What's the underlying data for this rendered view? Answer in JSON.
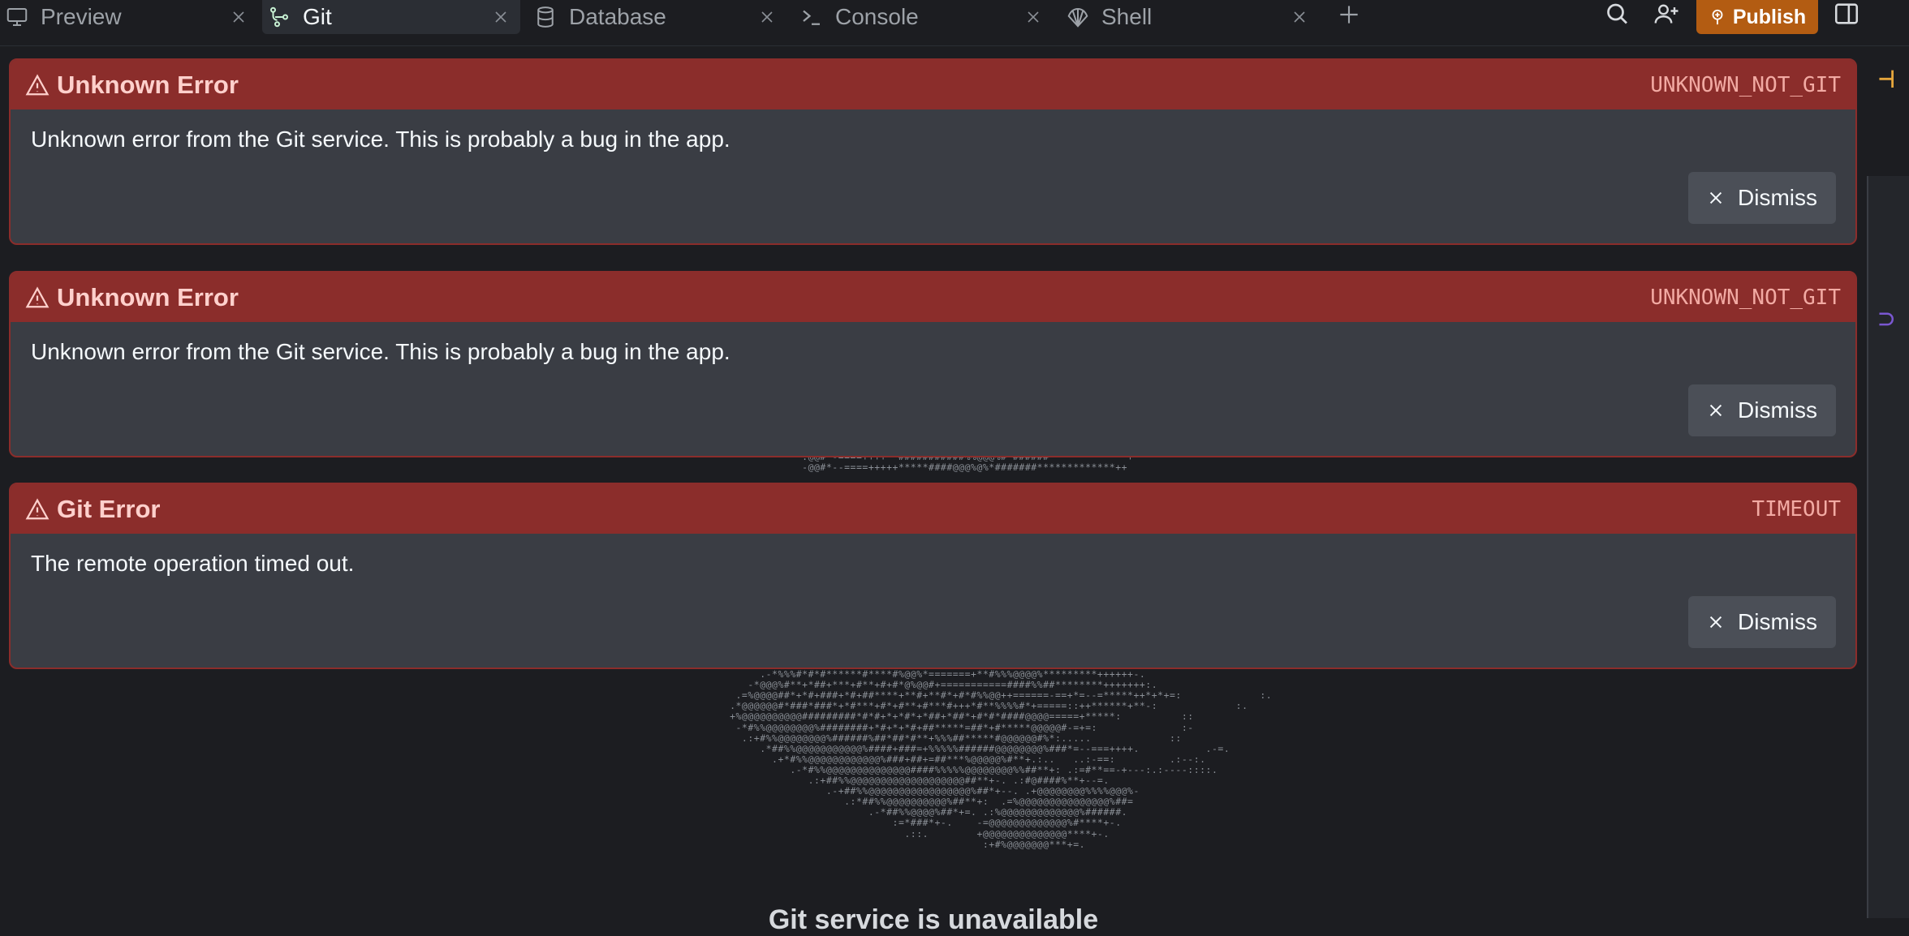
{
  "tabs": [
    {
      "label": "Preview",
      "icon": "monitor-icon",
      "active": false
    },
    {
      "label": "Git",
      "icon": "git-branch-icon",
      "active": true
    },
    {
      "label": "Database",
      "icon": "database-icon",
      "active": false
    },
    {
      "label": "Console",
      "icon": "terminal-icon",
      "active": false
    },
    {
      "label": "Shell",
      "icon": "shell-icon",
      "active": false
    }
  ],
  "header": {
    "publish_label": "Publish"
  },
  "errors": [
    {
      "title": "Unknown Error",
      "code": "UNKNOWN_NOT_GIT",
      "message": "Unknown error from the Git service. This is probably a bug in the app.",
      "dismiss_label": "Dismiss"
    },
    {
      "title": "Unknown Error",
      "code": "UNKNOWN_NOT_GIT",
      "message": "Unknown error from the Git service. This is probably a bug in the app.",
      "dismiss_label": "Dismiss"
    },
    {
      "title": "Git Error",
      "code": "TIMEOUT",
      "message": "The remote operation timed out.",
      "dismiss_label": "Dismiss"
    }
  ],
  "background": {
    "footer_message": "Git service is unavailable"
  },
  "colors": {
    "background": "#1c1d21",
    "error_header": "#8b2d2b",
    "card": "#3a3d44",
    "publish": "#b35c12"
  }
}
